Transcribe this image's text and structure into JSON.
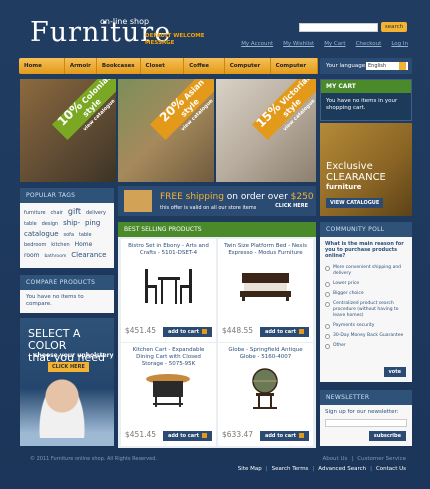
{
  "header": {
    "logo": "Furniture",
    "logo_sub": "on-line shop",
    "welcome": "DEFAULT WELCOME MESSAGE",
    "search_button": "search",
    "links": [
      "My Account",
      "My Wishlist",
      "My Cart",
      "Checkout",
      "Log In"
    ]
  },
  "nav": {
    "items": [
      "Home Furniture",
      "Armoir",
      "Bookcases",
      "Closet Storage",
      "Coffee Tables",
      "Computer Carts",
      "Computer Desks"
    ],
    "language_label": "Your language:",
    "language_value": "English"
  },
  "banners": [
    {
      "percent": "10%",
      "line1": "Colonial style",
      "line2": "view catalogue"
    },
    {
      "percent": "20%",
      "line1": "Asian style",
      "line2": "view catalogue"
    },
    {
      "percent": "15%",
      "line1": "Victorian style",
      "line2": "view catalogue"
    }
  ],
  "cart": {
    "title": "MY CART",
    "empty": "You have no items in your shopping cart."
  },
  "clearance": {
    "line1": "Exclusive",
    "line2": "CLEARANCE",
    "line3": "furniture",
    "cta": "VIEW CATALOGUE"
  },
  "tags": {
    "title": "POPULAR TAGS",
    "items": [
      "furniture",
      "chair",
      "gift",
      "delivery",
      "table",
      "design",
      "ship-",
      "ping",
      "catalogue",
      "sofa",
      "table",
      "bedroom",
      "kitchen",
      "Home",
      "room",
      "bathroom",
      "Clearance"
    ]
  },
  "compare": {
    "title": "COMPARE PRODUCTS",
    "text": "You have no items to compare."
  },
  "color_promo": {
    "line1": "SELECT A COLOR",
    "line2": "that you need",
    "line3": "choose your upholstery",
    "cta": "CLICK HERE"
  },
  "shipping": {
    "free": "FREE shipping",
    "order": "on order over",
    "amount": "$250",
    "sub": "this offer is valid on all our store items",
    "cta": "CLICK HERE"
  },
  "best_selling": {
    "title": "BEST SELLING PRODUCTS",
    "add_label": "add to cart",
    "products": [
      {
        "name": "Bistro Set in Ebony - Arts and Crafts - 5101-DSET-4",
        "price": "$451.45"
      },
      {
        "name": "Twin Size Platform Bed - Nexis Espresso - Modus Furniture",
        "price": "$448.55"
      },
      {
        "name": "Kitchen Cart - Expandable Dining Cart with Closed Storage - 5075-95K",
        "price": "$451.45"
      },
      {
        "name": "Globe - Springfield Antique Globe - 5160-4007",
        "price": "$633.47"
      }
    ]
  },
  "poll": {
    "title": "COMMUNITY POLL",
    "question": "What is the main reason for you to purchase products online?",
    "options": [
      "More convenient shipping and delivery",
      "Lower price",
      "Bigger choice",
      "Centralized product search procedure (without having to leave homes)",
      "Payments security",
      "30-Day Money Back Guarantee",
      "Other"
    ],
    "vote": "vote"
  },
  "newsletter": {
    "title": "NEWSLETTER",
    "label": "Sign up for our newsletter:",
    "button": "subscribe"
  },
  "footer": {
    "copyright": "© 2011 Furniture online shop. All Rights Reserved.",
    "links1": [
      "About Us",
      "Customer Service"
    ],
    "links2": [
      "Site Map",
      "Search Terms",
      "Advanced Search",
      "Contact Us"
    ]
  }
}
